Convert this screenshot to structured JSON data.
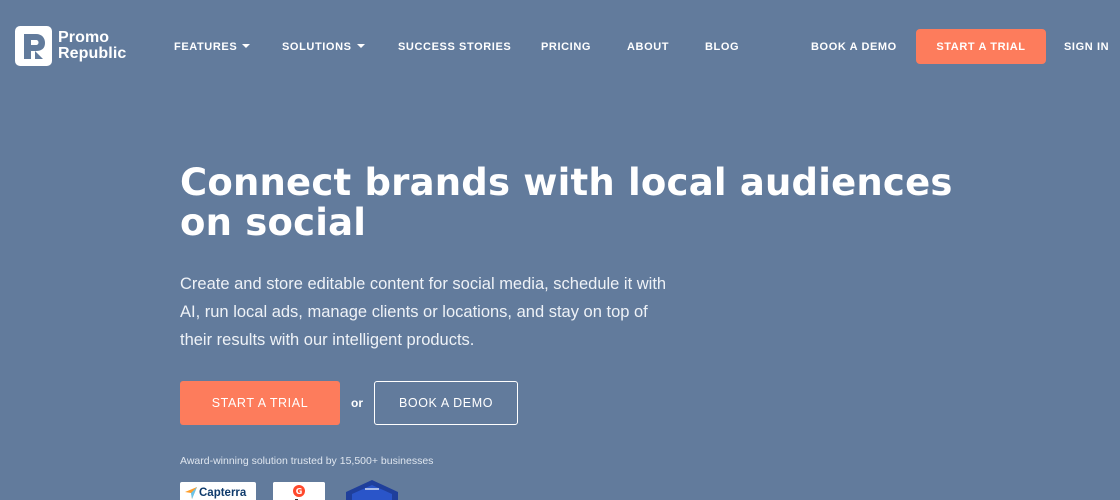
{
  "brand": {
    "line1": "Promo",
    "line2": "Republic",
    "accent": "#fd7c5c",
    "background": "#627b9c"
  },
  "nav": {
    "items": [
      {
        "label": "FEATURES",
        "dropdown": true
      },
      {
        "label": "SOLUTIONS",
        "dropdown": true
      },
      {
        "label": "SUCCESS STORIES",
        "dropdown": false
      },
      {
        "label": "PRICING",
        "dropdown": false
      },
      {
        "label": "ABOUT",
        "dropdown": false
      },
      {
        "label": "BLOG",
        "dropdown": false
      }
    ],
    "book_demo": "BOOK A DEMO",
    "start_trial": "START A TRIAL",
    "sign_in": "SIGN IN"
  },
  "hero": {
    "title_line1": "Connect brands with local audiences",
    "title_line2": "on social",
    "subtitle": "Create and store editable content for social media, schedule it with AI, run local ads, manage clients or locations, and stay on top of their results with our intelligent products.",
    "cta_trial": "START A TRIAL",
    "or": "or",
    "cta_demo": "BOOK A DEMO",
    "trust_text": "Award-winning solution trusted by 15,500+ businesses"
  },
  "badges": {
    "capterra": "Capterra",
    "g2_icon": "g2-logo-icon",
    "shield_icon": "award-shield-icon"
  }
}
